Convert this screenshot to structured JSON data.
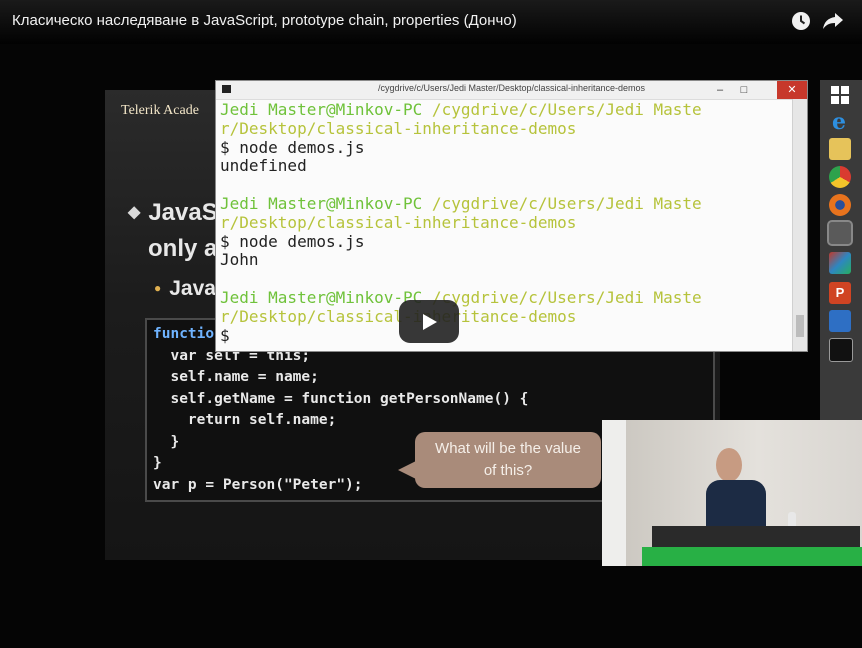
{
  "video": {
    "title": "Класическо наследяване в JavaScript, prototype chain, properties (Дончо)",
    "watch_later_icon": "clock-icon",
    "share_icon": "share-arrow-icon",
    "play_icon": "play-icon"
  },
  "slide": {
    "logo": "Telerik Acade",
    "bullet_main_line1": "JavaS",
    "bullet_main_line2": "only a",
    "bullet_sub": "Java",
    "code_lines": [
      "functio",
      "  var self = this;",
      "  self.name = name;",
      "  self.getName = function getPersonName() {",
      "    return self.name;",
      "  }",
      "}",
      "var p = Person(\"Peter\");"
    ],
    "callout": "What will be the value of this?"
  },
  "terminal": {
    "title": "/cygdrive/c/Users/Jedi Master/Desktop/classical-inheritance-demos",
    "blocks": [
      {
        "user": "Jedi Master@Minkov-PC",
        "path_line1": " /cygdrive/c/Users/Jedi Maste",
        "path_line2": "r/Desktop/classical-inheritance-demos",
        "cmd": "$ node demos.js",
        "output": "undefined"
      },
      {
        "user": "Jedi Master@Minkov-PC",
        "path_line1": " /cygdrive/c/Users/Jedi Maste",
        "path_line2": "r/Desktop/classical-inheritance-demos",
        "cmd": "$ node demos.js",
        "output": "John"
      },
      {
        "user": "Jedi Master@Minkov-PC",
        "path_line1": " /cygdrive/c/Users/Jedi Maste",
        "path_line2": "r/Desktop/classical-inheritance-demos",
        "cmd": "$ ",
        "output": ""
      }
    ]
  },
  "taskbar_icons": [
    "windows-logo-icon",
    "internet-explorer-icon",
    "file-explorer-icon",
    "chrome-icon",
    "firefox-icon",
    "terminal-icon",
    "paint-icon",
    "powerpoint-icon",
    "visual-studio-icon",
    "console-icon"
  ],
  "colors": {
    "terminal_user": "#6fc23a",
    "terminal_path": "#b6c33b",
    "callout": "#a98b7a",
    "keyword": "#6fb3ff",
    "close_button": "#c7382b"
  }
}
